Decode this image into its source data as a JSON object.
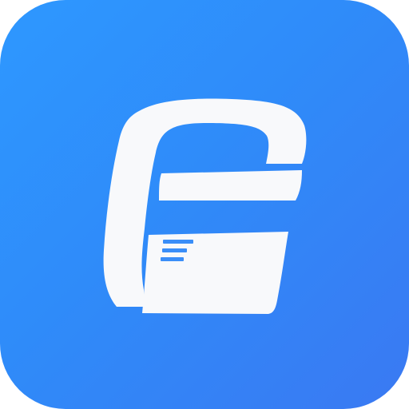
{
  "app_icon": {
    "name": "app-icon",
    "description_visible_text": "",
    "colors": {
      "background_top_left": "#2e98ff",
      "background_bottom_right": "#3a79f2",
      "glyph": "#f8f9fb",
      "lines": "#3a8ef8"
    }
  }
}
